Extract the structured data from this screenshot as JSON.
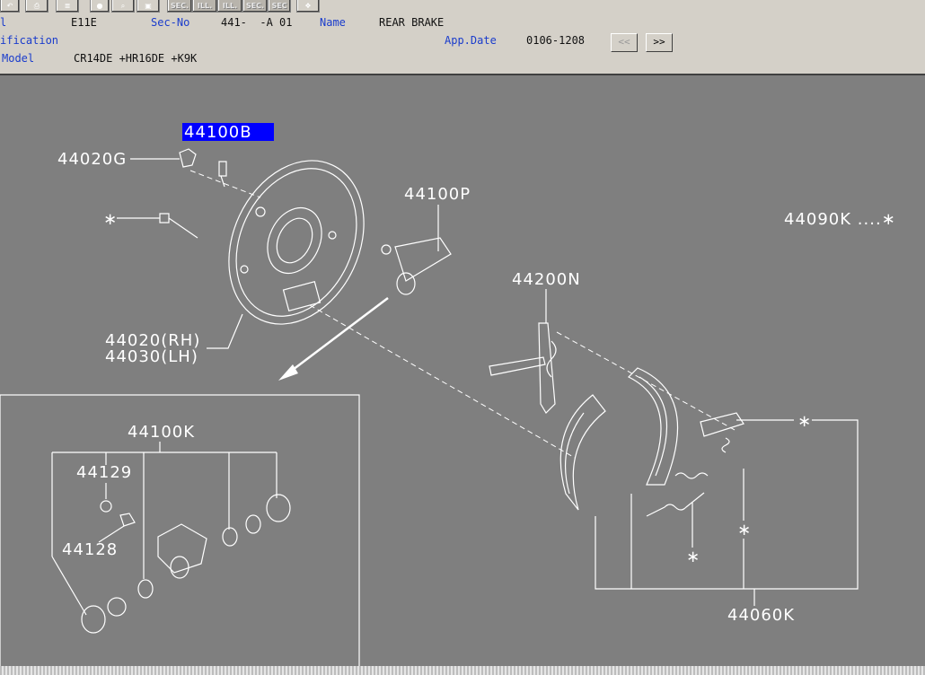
{
  "toolbar": {
    "buttons": [
      "SEC.",
      "ILL.",
      "ILL.",
      "SEC.",
      "SEC"
    ]
  },
  "header": {
    "row1_lbl1": "l",
    "row1_val1": "E11E",
    "sec_no_label": "Sec-No",
    "sec_no_value": "441-  -A 01",
    "name_label": "Name",
    "name_value": "REAR BRAKE",
    "spec_label": "ification",
    "app_date_label": "App.Date",
    "app_date_value": "0106-1208",
    "prev_label": "<<",
    "next_label": ">>",
    "model_label": "Model",
    "model_value": "CR14DE +HR16DE +K9K"
  },
  "parts": {
    "p44100B": "44100B",
    "p44020G": "44020G",
    "p44100P": "44100P",
    "p44090K": "44090K ....∗",
    "p44200N": "44200N",
    "p44020RH": "44020(RH)",
    "p44030LH": "44030(LH)",
    "p44100K": "44100K",
    "p44129": "44129",
    "p44128": "44128",
    "p44060K": "44060K",
    "asterisk": "∗"
  },
  "colors": {
    "highlight": "#0000ff",
    "background": "#7f7f7f"
  }
}
